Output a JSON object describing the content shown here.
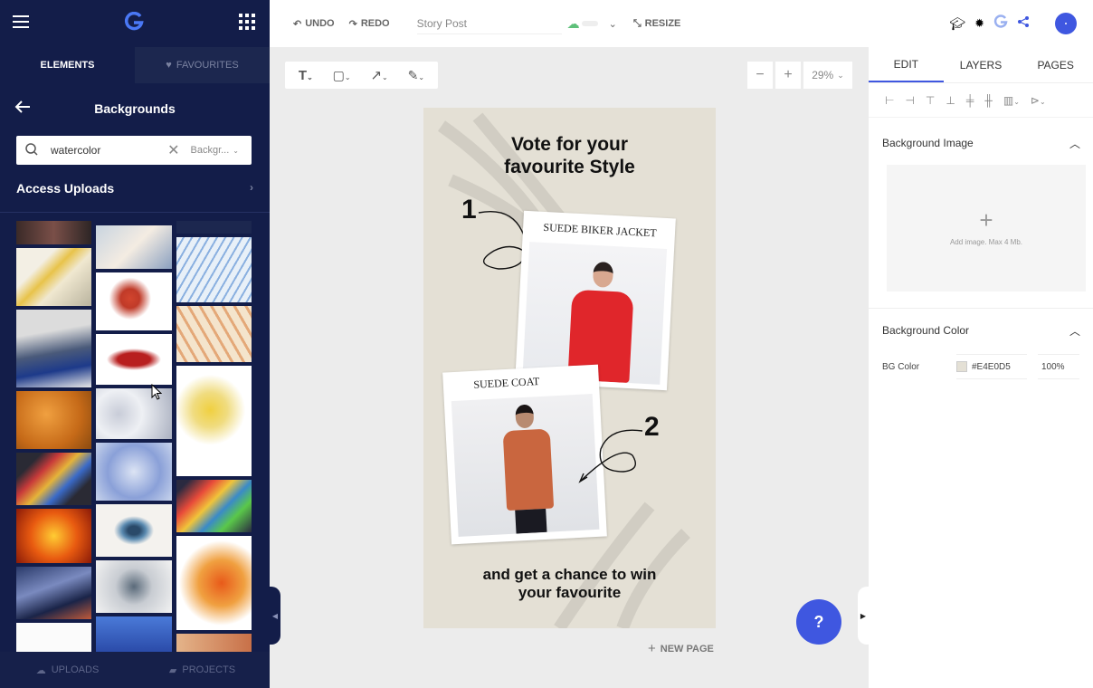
{
  "sidebar": {
    "tabs": {
      "elements": "ELEMENTS",
      "favourites": "FAVOURITES"
    },
    "title": "Backgrounds",
    "search": {
      "value": "watercolor",
      "filter": "Backgr..."
    },
    "access_uploads": "Access Uploads",
    "bottom": {
      "uploads": "UPLOADS",
      "projects": "PROJECTS"
    }
  },
  "topbar": {
    "undo": "UNDO",
    "redo": "REDO",
    "doc_name": "Story Post",
    "resize": "RESIZE"
  },
  "zoom": {
    "minus": "−",
    "plus": "+",
    "level": "29%"
  },
  "poster": {
    "headline": "Vote for your favourite Style",
    "num1": "1",
    "label1": "SUEDE BIKER JACKET",
    "label2": "SUEDE COAT",
    "num2": "2",
    "footer": "and get a chance to win your favourite"
  },
  "canvas": {
    "new_page": "NEW PAGE",
    "help": "?"
  },
  "right_panel": {
    "tabs": {
      "edit": "EDIT",
      "layers": "LAYERS",
      "pages": "PAGES"
    },
    "bg_image": {
      "title": "Background Image",
      "hint": "Add image. Max 4 Mb."
    },
    "bg_color": {
      "title": "Background Color",
      "label": "BG Color",
      "hex": "#E4E0D5",
      "opacity": "100%"
    }
  },
  "colors": {
    "sidebar": "#131d49",
    "accent": "#3f57e0",
    "poster_bg": "#E4E0D5",
    "jacket_red": "#e0262b",
    "coat_orange": "#c9663f"
  }
}
